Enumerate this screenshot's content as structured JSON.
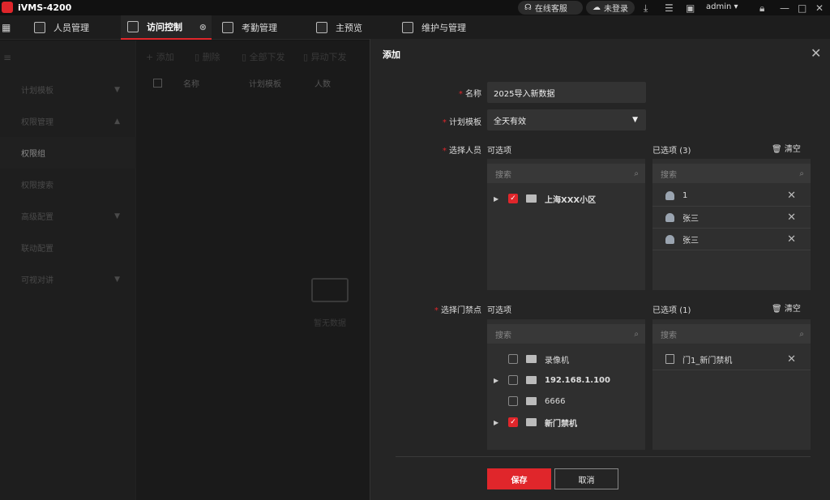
{
  "app": {
    "title": "iVMS-4200"
  },
  "titlebar": {
    "online_service": "在线客服",
    "login_status": "未登录",
    "user": "admin"
  },
  "tabs": [
    {
      "label": "人员管理"
    },
    {
      "label": "访问控制",
      "active": true
    },
    {
      "label": "考勤管理"
    },
    {
      "label": "主预览"
    },
    {
      "label": "维护与管理"
    }
  ],
  "sidebar": {
    "items": [
      {
        "label": "计划模板"
      },
      {
        "label": "权限管理"
      },
      {
        "label": "权限组"
      },
      {
        "label": "权限搜索"
      },
      {
        "label": "高级配置"
      },
      {
        "label": "联动配置"
      },
      {
        "label": "可视对讲"
      }
    ]
  },
  "toolbar": {
    "add": "添加",
    "delete": "删除",
    "issue_all": "全部下发",
    "issue_changed": "异动下发"
  },
  "table": {
    "columns": [
      "名称",
      "计划模板",
      "人数"
    ],
    "empty_text": "暂无数据"
  },
  "dialog": {
    "title": "添加",
    "name_label": "名称",
    "name_value": "2025导入新数据",
    "template_label": "计划模板",
    "template_value": "全天有效",
    "select_person_label": "选择人员",
    "select_door_label": "选择门禁点",
    "available_label": "可选项",
    "selected_persons_label": "已选项",
    "selected_persons_count": "(3)",
    "selected_doors_label": "已选项",
    "selected_doors_count": "(1)",
    "clear": "清空",
    "search_placeholder": "搜索",
    "person_tree": [
      {
        "label": "上海XXX小区",
        "checked": true,
        "expandable": true
      }
    ],
    "selected_persons": [
      {
        "label": "1"
      },
      {
        "label": "张三"
      },
      {
        "label": "张三"
      }
    ],
    "door_tree": [
      {
        "label": "录像机",
        "checked": false,
        "expandable": false
      },
      {
        "label": "192.168.1.100",
        "checked": false,
        "expandable": true
      },
      {
        "label": "6666",
        "checked": false,
        "expandable": false
      },
      {
        "label": "新门禁机",
        "checked": true,
        "expandable": true
      }
    ],
    "selected_doors": [
      {
        "label": "门1_新门禁机"
      }
    ],
    "save": "保存",
    "cancel": "取消"
  },
  "colors": {
    "accent": "#e0262b",
    "dialog_bg": "#252525",
    "panel_bg": "#2f2f2f"
  }
}
